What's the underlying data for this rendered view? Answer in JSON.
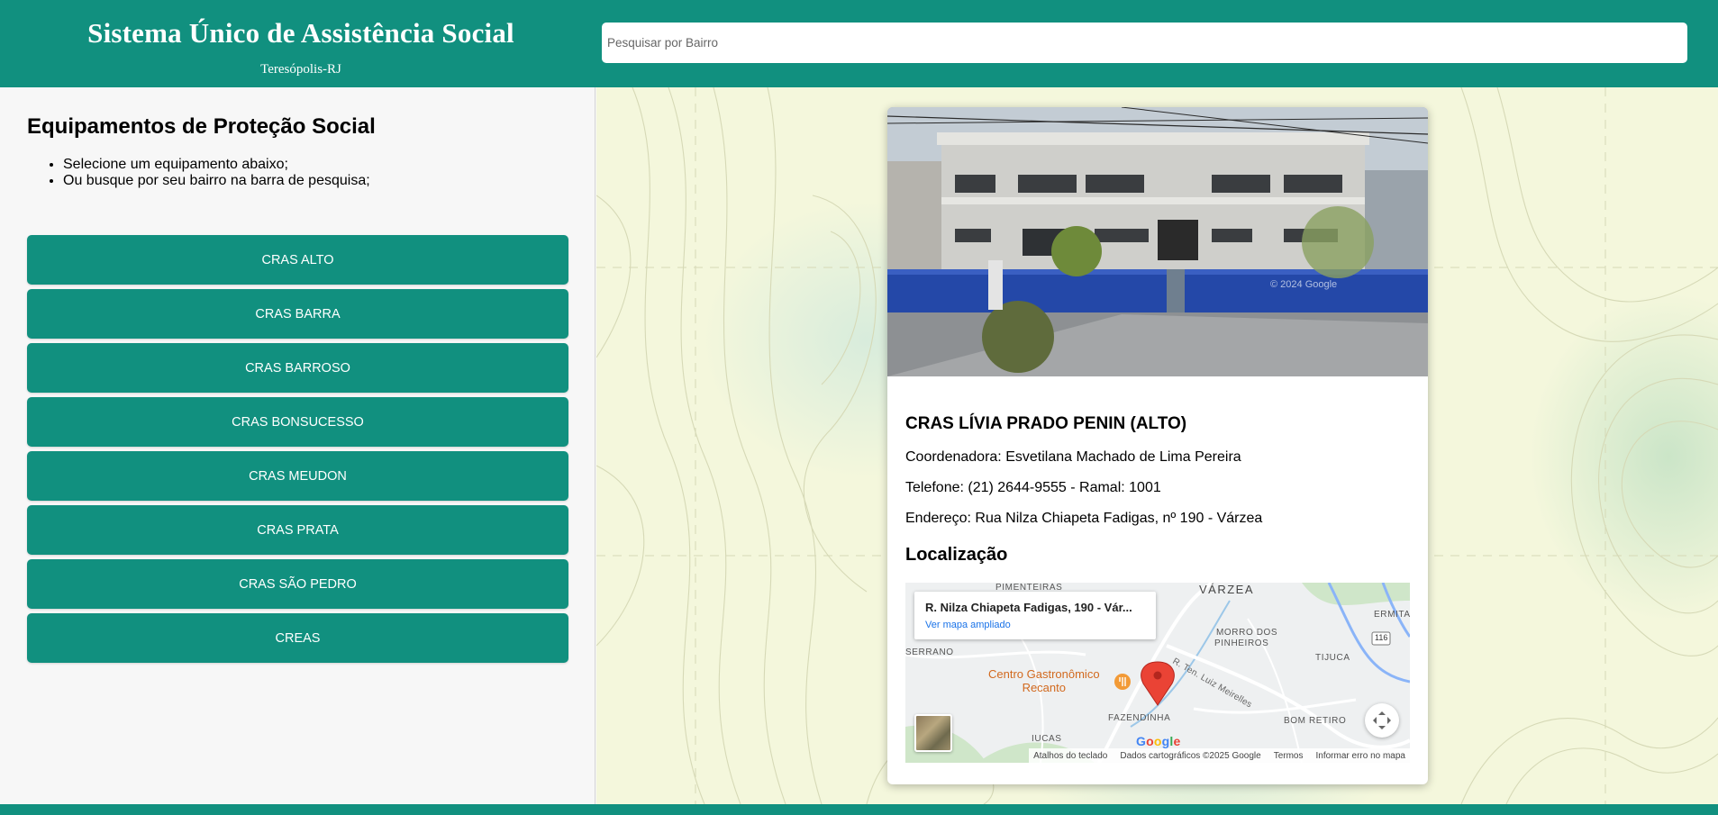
{
  "header": {
    "title": "Sistema Único de Assistência Social",
    "subtitle": "Teresópolis-RJ",
    "search_placeholder": "Pesquisar por Bairro"
  },
  "sidebar": {
    "title": "Equipamentos de Proteção Social",
    "instructions": [
      "Selecione um equipamento abaixo;",
      "Ou busque por seu bairro na barra de pesquisa;"
    ],
    "buttons": [
      "CRAS ALTO",
      "CRAS BARRA",
      "CRAS BARROSO",
      "CRAS BONSUCESSO",
      "CRAS MEUDON",
      "CRAS PRATA",
      "CRAS SÃO PEDRO",
      "CREAS"
    ]
  },
  "card": {
    "name": "CRAS LÍVIA PRADO PENIN (ALTO)",
    "coordinator": "Coordenadora: Esvetilana Machado de Lima Pereira",
    "phone": "Telefone: (21) 2644-9555 - Ramal: 1001",
    "address": "Endereço: Rua Nilza Chiapeta Fadigas, nº 190 - Várzea",
    "location_heading": "Localização",
    "photo_watermark": "© 2024 Google"
  },
  "minimap": {
    "popup_address": "R. Nilza Chiapeta Fadigas, 190 - Vár...",
    "popup_link": "Ver mapa ampliado",
    "labels": {
      "pimenteiras": "PIMENTEIRAS",
      "varzea": "VÁRZEA",
      "ermita": "ERMITA",
      "morro": "MORRO DOS",
      "pinheiros": "PINHEIROS",
      "serrano": "SERRANO",
      "tijuca": "TIJUCA",
      "street": "R. Ten. Luiz Meirelles",
      "fazendinha": "FAZENDINHA",
      "bom_retiro": "BOM RETIRO",
      "iucas": "IUCAS",
      "route": "116"
    },
    "poi_line1": "Centro Gastronômico",
    "poi_line2": "Recanto",
    "google": "Google",
    "attribution": [
      "Atalhos do teclado",
      "Dados cartográficos ©2025 Google",
      "Termos",
      "Informar erro no mapa"
    ]
  },
  "colors": {
    "primary": "#11907f",
    "background": "#f7f7f7",
    "map_background": "#f4f7dc",
    "marker": "#ea4335"
  }
}
